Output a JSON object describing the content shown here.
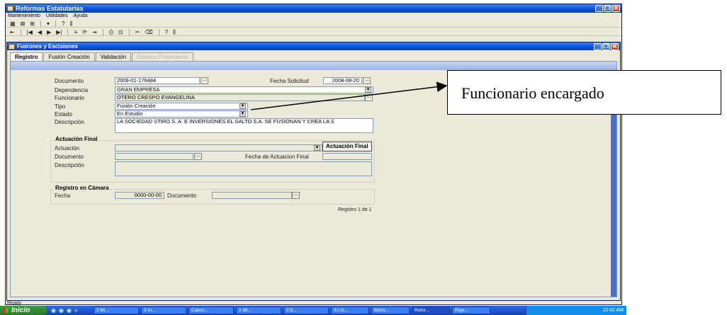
{
  "outer_window": {
    "title": "Reformas Estatutarias",
    "menu": [
      "Mantenimiento",
      "Utilidades",
      "Ayuda"
    ],
    "toolbar1": [
      "▦",
      "⊠",
      "⊞",
      "▾",
      "?",
      "⫼"
    ],
    "toolbar2": [
      "⇤",
      "|◀",
      "◀",
      "▶",
      "▶|",
      "≡",
      "⟳",
      "⇥",
      "⎙",
      "⊡",
      "✂",
      "⌫",
      "?",
      "⫼"
    ]
  },
  "inner_window": {
    "title": "Fusiones y Escisiones",
    "tabs": [
      "Registro",
      "Fusión Creación",
      "Validación",
      "Estados Financieros"
    ]
  },
  "form": {
    "documento_label": "Documento",
    "documento_value": "2008-01-176484",
    "fecha_solicitud_label": "Fecha Solicitud",
    "fecha_solicitud_value": "2008-08-20",
    "dependencia_label": "Dependencia",
    "dependencia_value": "GRAN EMPRESA",
    "funcionario_label": "Funcionario",
    "funcionario_value": "OTERO CRESPO EVANGELINA",
    "tipo_label": "Tipo",
    "tipo_value": "Fusión Creación",
    "estado_label": "Estado",
    "estado_value": "En Estudio",
    "descripcion_label": "Descripción",
    "descripcion_value": "LA SOCIEDAD STIRO S. A. E INVERSIONES EL SALTO S.A. SE FUSIONAN Y CREA LA S"
  },
  "actuacion_final": {
    "group_title": "Actuación Final",
    "actuacion_label": "Actuación",
    "documento_label": "Documento",
    "fecha_label": "Fecha de Actuacion Final",
    "descripcion_label": "Descripción",
    "button_label": "Actuación Final"
  },
  "registro_camara": {
    "group_title": "Registro en Cámara",
    "fecha_label": "Fecha",
    "fecha_value": "0000-00-00",
    "documento_label": "Documento"
  },
  "record_counter": "Registro 1 de 1",
  "status_text": "Ready",
  "callout_text": "Funcionario encargado",
  "taskbar": {
    "start_label": "Inicio",
    "quick_launch": [
      "◉",
      "◉",
      "◉",
      "»"
    ],
    "tasks": [
      "2 Mi...",
      "3 In...",
      "Calcul...",
      "2 Mi...",
      "2 E...",
      "S.I.G...",
      "Micro...",
      "Refor...",
      "Repr..."
    ],
    "tray_time": "10:42 AM"
  },
  "colors": {
    "title_bar": "#0a4fd6",
    "window_face": "#ece9d8",
    "taskbar": "#245edb",
    "start_button": "#2b7a2b"
  }
}
